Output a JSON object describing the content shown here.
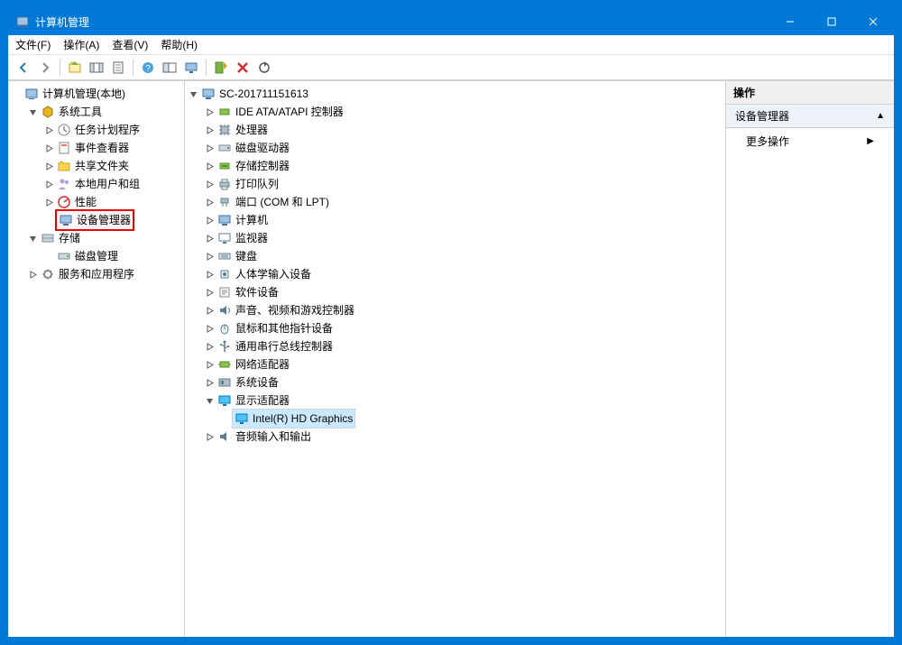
{
  "title": "计算机管理",
  "menu": {
    "file": "文件(F)",
    "action": "操作(A)",
    "view": "查看(V)",
    "help": "帮助(H)"
  },
  "left": {
    "root": "计算机管理(本地)",
    "sysTools": "系统工具",
    "taskSched": "任务计划程序",
    "eventViewer": "事件查看器",
    "sharedFolders": "共享文件夹",
    "localUsers": "本地用户和组",
    "perf": "性能",
    "devMgr": "设备管理器",
    "storage": "存储",
    "diskMgmt": "磁盘管理",
    "services": "服务和应用程序"
  },
  "center": {
    "host": "SC-201711151613",
    "ide": "IDE ATA/ATAPI 控制器",
    "cpu": "处理器",
    "diskDrives": "磁盘驱动器",
    "storageCtrl": "存储控制器",
    "printQueue": "打印队列",
    "ports": "端口 (COM 和 LPT)",
    "computer": "计算机",
    "monitor": "监视器",
    "keyboard": "键盘",
    "hid": "人体学输入设备",
    "software": "软件设备",
    "sound": "声音、视频和游戏控制器",
    "mouse": "鼠标和其他指针设备",
    "usb": "通用串行总线控制器",
    "network": "网络适配器",
    "sysDev": "系统设备",
    "display": "显示适配器",
    "displayItem": "Intel(R) HD Graphics",
    "audioIO": "音频输入和输出"
  },
  "right": {
    "hdr": "操作",
    "section": "设备管理器",
    "more": "更多操作"
  }
}
